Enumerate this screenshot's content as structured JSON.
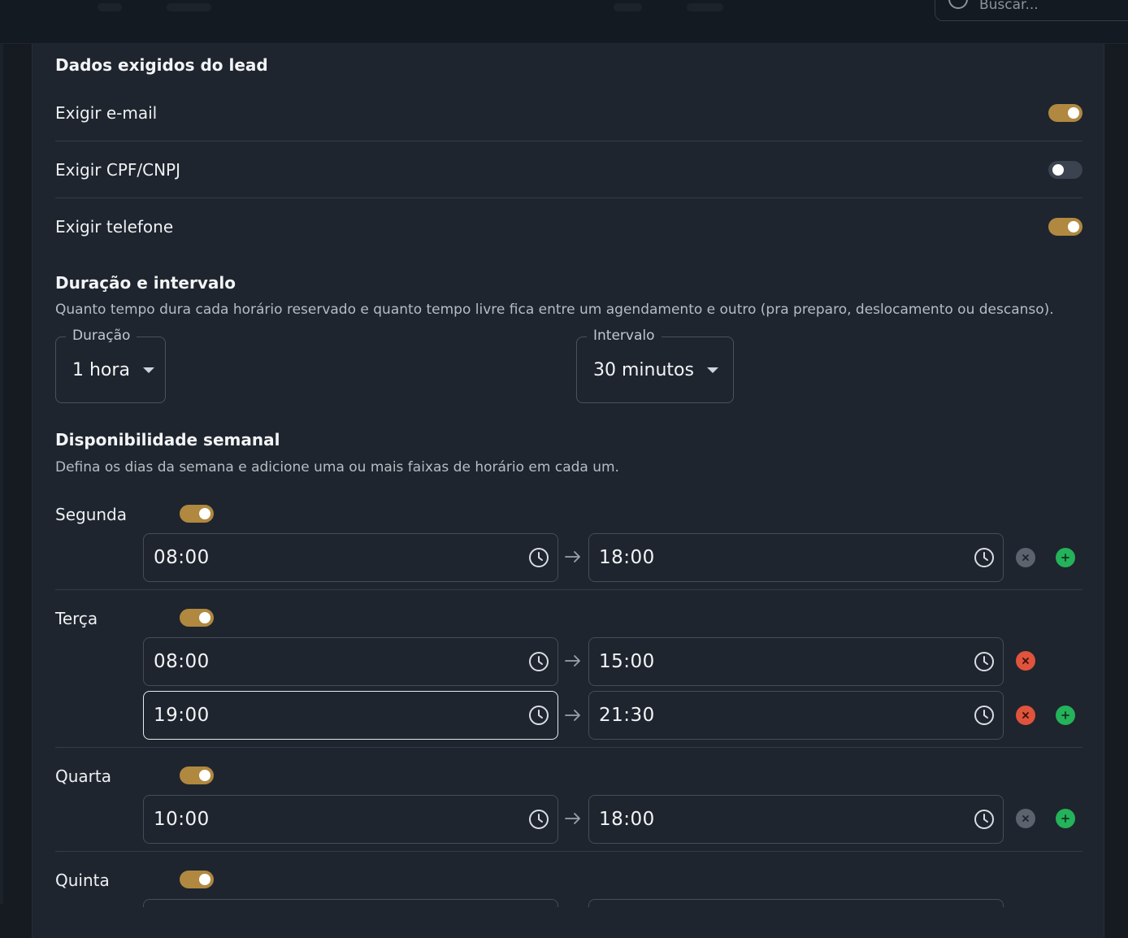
{
  "header": {
    "search_placeholder": "Buscar..."
  },
  "colors": {
    "accent": "#b08840",
    "danger": "#e0533c",
    "success": "#24b25a",
    "panel": "#1e252e"
  },
  "lead": {
    "title": "Dados exigidos do lead",
    "items": [
      {
        "label": "Exigir e-mail",
        "enabled": true
      },
      {
        "label": "Exigir CPF/CNPJ",
        "enabled": false
      },
      {
        "label": "Exigir telefone",
        "enabled": true
      }
    ]
  },
  "duration": {
    "title": "Duração e intervalo",
    "description": "Quanto tempo dura cada horário reservado e quanto tempo livre fica entre um agendamento e outro (pra preparo, deslocamento ou descanso).",
    "duration_label": "Duração",
    "duration_value": "1 hora",
    "interval_label": "Intervalo",
    "interval_value": "30 minutos"
  },
  "weekly": {
    "title": "Disponibilidade semanal",
    "description": "Defina os dias da semana e adicione uma ou mais faixas de horário em cada um.",
    "days": [
      {
        "name": "Segunda",
        "enabled": true,
        "ranges": [
          {
            "start": "08:00",
            "end": "18:00"
          }
        ]
      },
      {
        "name": "Terça",
        "enabled": true,
        "ranges": [
          {
            "start": "08:00",
            "end": "15:00"
          },
          {
            "start": "19:00",
            "end": "21:30"
          }
        ]
      },
      {
        "name": "Quarta",
        "enabled": true,
        "ranges": [
          {
            "start": "10:00",
            "end": "18:00"
          }
        ]
      },
      {
        "name": "Quinta",
        "enabled": true,
        "ranges": []
      }
    ]
  }
}
